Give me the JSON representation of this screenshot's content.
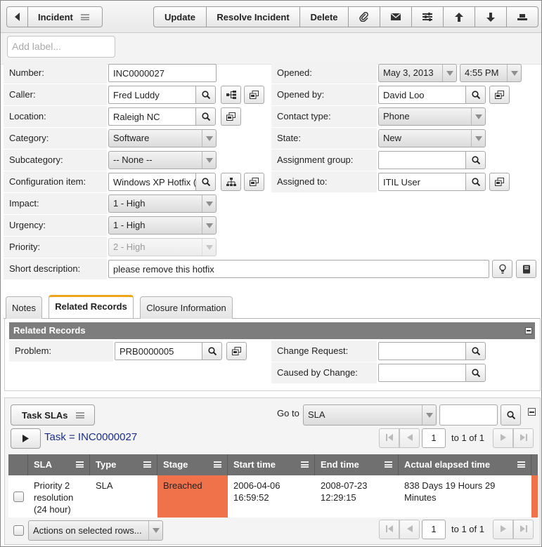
{
  "toolbar": {
    "title": "Incident",
    "buttons": [
      "Update",
      "Resolve Incident",
      "Delete"
    ]
  },
  "label_bar": {
    "placeholder": "Add label..."
  },
  "form": {
    "number": {
      "label": "Number:",
      "value": "INC0000027"
    },
    "caller": {
      "label": "Caller:",
      "value": "Fred Luddy"
    },
    "location": {
      "label": "Location:",
      "value": "Raleigh NC"
    },
    "category": {
      "label": "Category:",
      "value": "Software"
    },
    "subcategory": {
      "label": "Subcategory:",
      "value": "-- None --"
    },
    "config_item": {
      "label": "Configuration item:",
      "value": "Windows XP Hotfix ("
    },
    "impact": {
      "label": "Impact:",
      "value": "1 - High"
    },
    "urgency": {
      "label": "Urgency:",
      "value": "1 - High"
    },
    "priority": {
      "label": "Priority:",
      "value": "2 - High"
    },
    "short_description": {
      "label": "Short description:",
      "value": "please remove this hotfix"
    },
    "opened": {
      "label": "Opened:",
      "date": "May 3, 2013",
      "time": "4:55 PM"
    },
    "opened_by": {
      "label": "Opened by:",
      "value": "David Loo"
    },
    "contact_type": {
      "label": "Contact type:",
      "value": "Phone"
    },
    "state": {
      "label": "State:",
      "value": "New"
    },
    "assignment_group": {
      "label": "Assignment group:",
      "value": ""
    },
    "assigned_to": {
      "label": "Assigned to:",
      "value": "ITIL User"
    },
    "mandatory_color": "#f0a31c"
  },
  "tabs": [
    {
      "label": "Notes",
      "active": false
    },
    {
      "label": "Related Records",
      "active": true
    },
    {
      "label": "Closure Information",
      "active": false
    }
  ],
  "related": {
    "title": "Related Records",
    "problem": {
      "label": "Problem:",
      "value": "PRB0000005"
    },
    "change_request": {
      "label": "Change Request:",
      "value": ""
    },
    "caused_by_change": {
      "label": "Caused by Change:",
      "value": ""
    }
  },
  "sla": {
    "title": "Task SLAs",
    "goto_label": "Go to",
    "goto_field": "SLA",
    "filter_text": "Task = INC0000027",
    "page": "1",
    "page_of": "to 1 of 1",
    "columns": [
      "SLA",
      "Type",
      "Stage",
      "Start time",
      "End time",
      "Actual elapsed time"
    ],
    "rows": [
      {
        "sla": "Priority 2 resolution (24 hour)",
        "type": "SLA",
        "stage": "Breached",
        "start": "2006-04-06 16:59:52",
        "end": "2008-07-23 12:29:15",
        "elapsed": "838 Days 19 Hours 29 Minutes"
      }
    ],
    "breached_color": "#f0724b",
    "actions_label": "Actions on selected rows..."
  }
}
